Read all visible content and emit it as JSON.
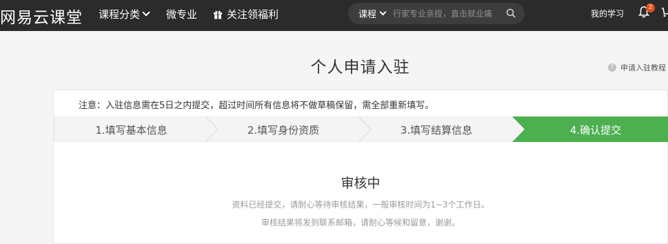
{
  "header": {
    "logo": "网易云课堂",
    "nav": [
      {
        "label": "课程分类"
      },
      {
        "label": "微专业"
      },
      {
        "label": "关注领福利"
      }
    ],
    "search": {
      "category": "课程",
      "placeholder": "行家专业亲授，直击就业痛"
    },
    "my_study": "我的学习",
    "notification_count": "2"
  },
  "page": {
    "title": "个人申请入驻",
    "help_link": "申请入驻教程",
    "notice": "注意：入驻信息需在5日之内提交，超过时间所有信息将不做草稿保留，需全部重新填写。",
    "steps": [
      {
        "label": "1.填写基本信息",
        "active": false
      },
      {
        "label": "2.填写身份资质",
        "active": false
      },
      {
        "label": "3.填写结算信息",
        "active": false
      },
      {
        "label": "4.确认提交",
        "active": true
      }
    ],
    "status": {
      "title": "审核中",
      "line1": "资料已经提交，请耐心等待审核结果，一般审核时间为1~3个工作日。",
      "line2": "审核结果将发到联系邮箱，请耐心等候和留意，谢谢。"
    }
  },
  "colors": {
    "topbar": "#2b2b2b",
    "step_active": "#4caf50",
    "step_inactive": "#f4f4f4",
    "badge": "#e94e1b"
  }
}
